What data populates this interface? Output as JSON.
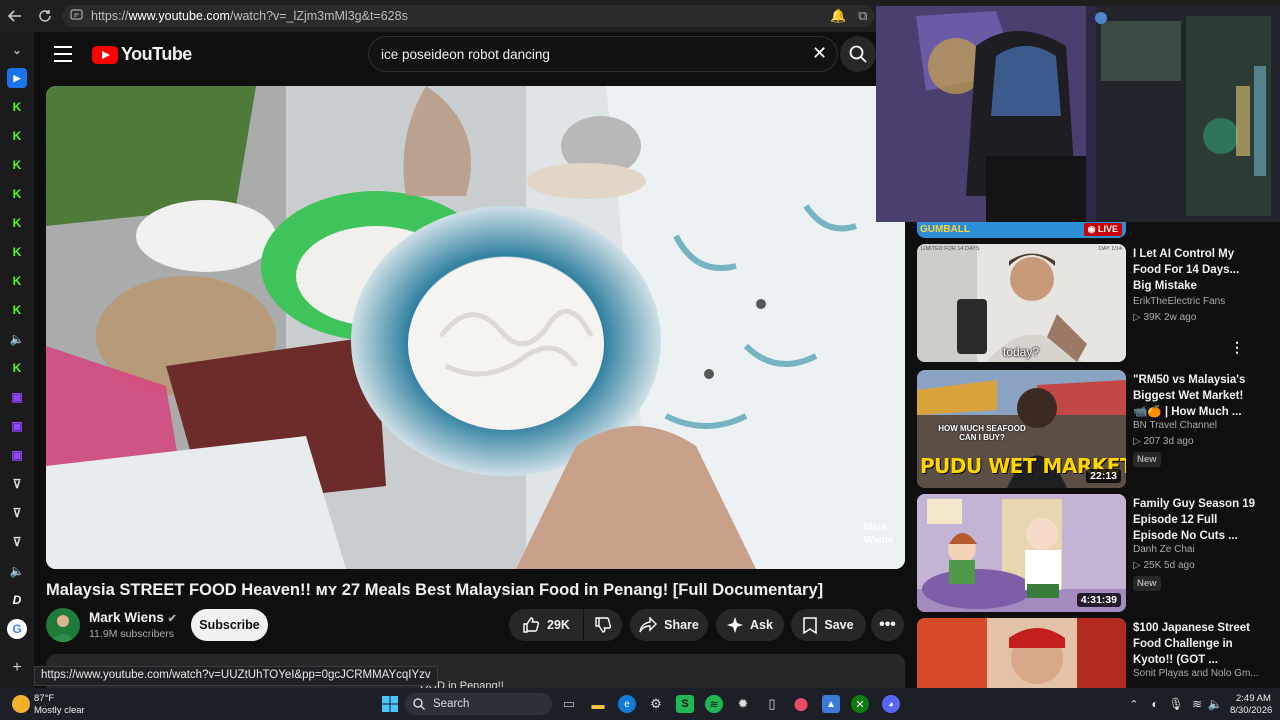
{
  "browser": {
    "url": "https://www.youtube.com/watch?v=_lZjm3mMl3g&t=628s",
    "url_prefix": "https://",
    "url_host": "www.youtube.com",
    "url_path": "/watch?v=_lZjm3mMl3g&t=628s"
  },
  "youtube": {
    "logo_text": "YouTube",
    "search_value": "ice poseideon robot dancing"
  },
  "video": {
    "watermark": "Mark\nWiens",
    "title": "Malaysia STREET FOOD Heaven!! ᴍʏ 27 Meals Best Malaysian Food in Penang! [Full Documentary]",
    "channel": "Mark Wiens",
    "subscribers": "11.9M subscribers",
    "subscribe_label": "Subscribe",
    "likes": "29K",
    "share_label": "Share",
    "ask_label": "Ask",
    "save_label": "Save",
    "desc_peek": "OOD in Penang!!"
  },
  "status_bar_url": "https://www.youtube.com/watch?v=UUZtUhTOYeI&pp=0gcJCRMMAYcqIYzv",
  "recommendations": [
    {
      "live_label": "LIVE",
      "thumb_text": "GUMBALL"
    },
    {
      "title": "I Let AI Control My Food For 14 Days... Big Mistake",
      "channel": "ErikTheElectric Fans",
      "meta": "▷ 39K  2w ago",
      "caption": "today?",
      "thumb_top_left": "LIMITED FOR 14 DAYS",
      "thumb_top_right": "DAY 1/14"
    },
    {
      "title": "\"RM50 vs Malaysia's Biggest Wet Market! 📹🍊 | How Much ...",
      "channel": "BN Travel Channel",
      "meta": "▷ 207  3d ago",
      "badge": "New",
      "duration": "22:13",
      "thumb_overlay": "HOW MUCH SEAFOOD CAN I BUY?",
      "thumb_big": "PUDU WET MARKET"
    },
    {
      "title": "Family Guy Season 19 Episode 12 Full Episode No Cuts ...",
      "channel": "Danh Ze Chai",
      "meta": "▷ 25K  5d ago",
      "badge": "New",
      "duration": "4:31:39"
    },
    {
      "title": "$100 Japanese Street Food Challenge in Kyoto!! (GOT ...",
      "channel": "Sonit Playas and Nolo Gm..."
    }
  ],
  "taskbar": {
    "temp": "87°F",
    "weather": "Mostly clear",
    "search_label": "Search",
    "time": "2:49 AM",
    "date": "8/30/2026"
  },
  "colors": {
    "yt_red": "#ff0000",
    "bg": "#0f0f0f",
    "pill": "#272727",
    "kick_green": "#53fc18",
    "twitch_purple": "#9146ff",
    "edge_blue": "#1a73e8"
  }
}
